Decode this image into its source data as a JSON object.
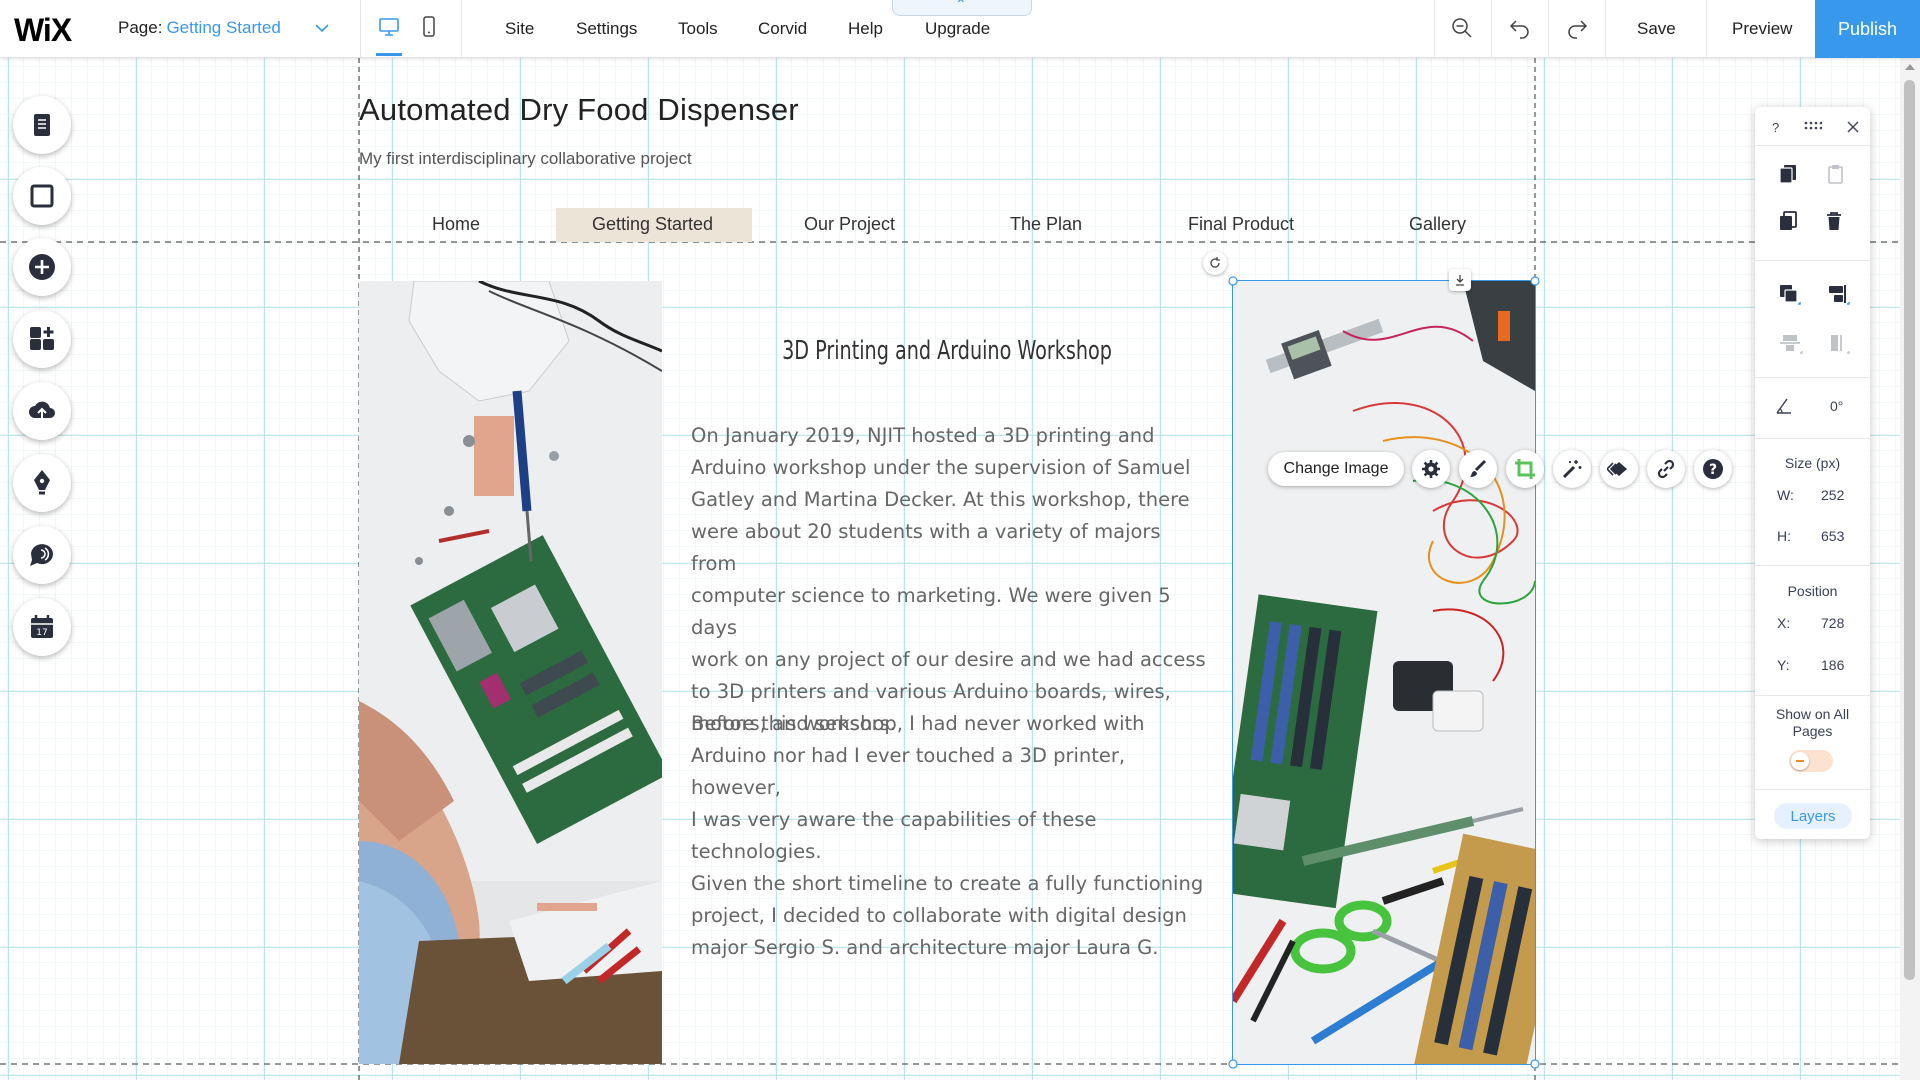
{
  "topbar": {
    "logo": "WiX",
    "page_prefix": "Page:",
    "page_name": "Getting Started",
    "menu": [
      "Site",
      "Settings",
      "Tools",
      "Corvid",
      "Help",
      "Upgrade"
    ],
    "save": "Save",
    "preview": "Preview",
    "publish": "Publish"
  },
  "site": {
    "title": "Automated Dry Food Dispenser",
    "subtitle": "My first interdisciplinary collaborative project",
    "nav": [
      "Home",
      "Getting Started",
      "Our Project",
      "The Plan",
      "Final Product",
      "Gallery"
    ],
    "active_nav": "Getting Started"
  },
  "article": {
    "title": "3D Printing and Arduino Workshop",
    "paragraphs": [
      [
        "On January 2019, NJIT hosted a 3D printing and",
        "Arduino workshop under the supervision of Samuel",
        "Gatley and Martina Decker. At this workshop, there",
        "were about 20 students with a variety of majors from",
        "computer science to marketing. We were given 5 days",
        "work on any project of our desire and we had access",
        "to 3D printers and various Arduino boards, wires,",
        "motors, and sensors."
      ],
      [
        "Before this workshop, I had never worked with",
        "Arduino nor had I ever touched a 3D printer, however,",
        "I was very aware the capabilities of these",
        "technologies."
      ],
      [
        "Given the short timeline to create a fully functioning",
        "project, I decided to collaborate with digital design",
        "major Sergio S. and architecture major Laura G."
      ]
    ]
  },
  "image_toolbar": {
    "change_image": "Change Image",
    "icons": [
      "settings-icon",
      "design-brush-icon",
      "crop-icon",
      "magic-wand-icon",
      "animation-icon",
      "link-icon",
      "help-icon"
    ]
  },
  "panel": {
    "help": "?",
    "rotation": "0°",
    "size_label": "Size (px)",
    "w_key": "W:",
    "w_val": "252",
    "h_key": "H:",
    "h_val": "653",
    "position_label": "Position",
    "x_key": "X:",
    "x_val": "728",
    "y_key": "Y:",
    "y_val": "186",
    "show_all_1": "Show on All",
    "show_all_2": "Pages",
    "show_all_on": false,
    "layers": "Layers"
  },
  "colors": {
    "accent": "#3899ec",
    "grid": "#bfe7ea",
    "nav_active_bg": "#ede4d8",
    "crop_green": "#5bc35b"
  }
}
